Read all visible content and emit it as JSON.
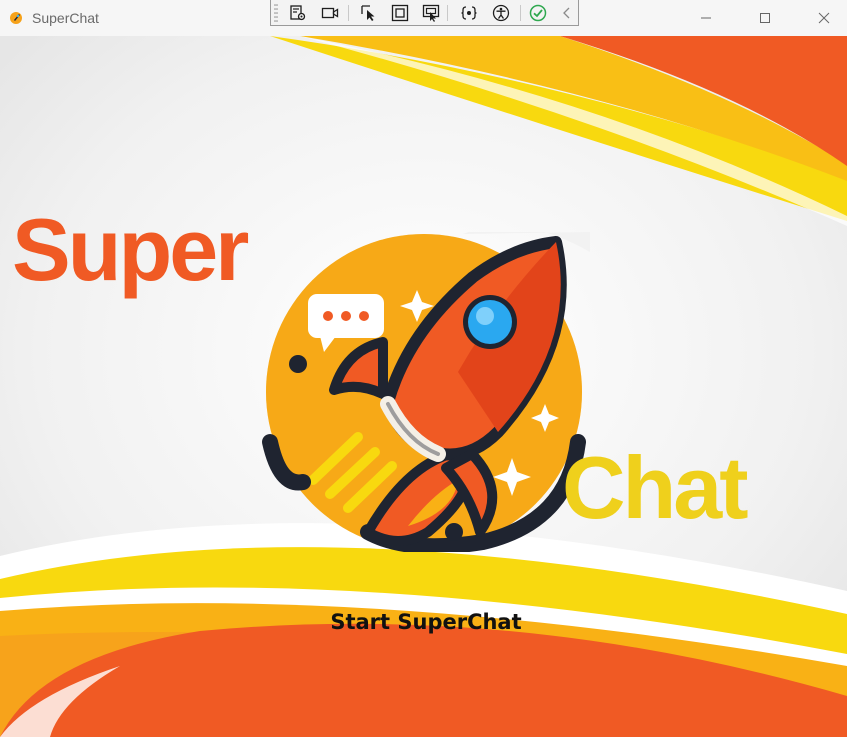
{
  "window": {
    "title": "SuperChat",
    "controls": [
      "minimize-icon",
      "maximize-icon",
      "close-icon"
    ]
  },
  "devbar": {
    "tools": [
      "live-visual-tree-icon",
      "record-icon",
      "select-element-icon",
      "display-layout-adorners-icon",
      "track-focused-element-icon",
      "binding-failures-icon",
      "accessibility-icon",
      "checked-icon",
      "collapse-chevron-icon"
    ]
  },
  "splash": {
    "word_super": "Super",
    "word_chat": "Chat",
    "start_label": "Start SuperChat"
  },
  "colors": {
    "orange": "#f05a24",
    "yellow": "#efd01c",
    "dark": "#1f2430"
  }
}
